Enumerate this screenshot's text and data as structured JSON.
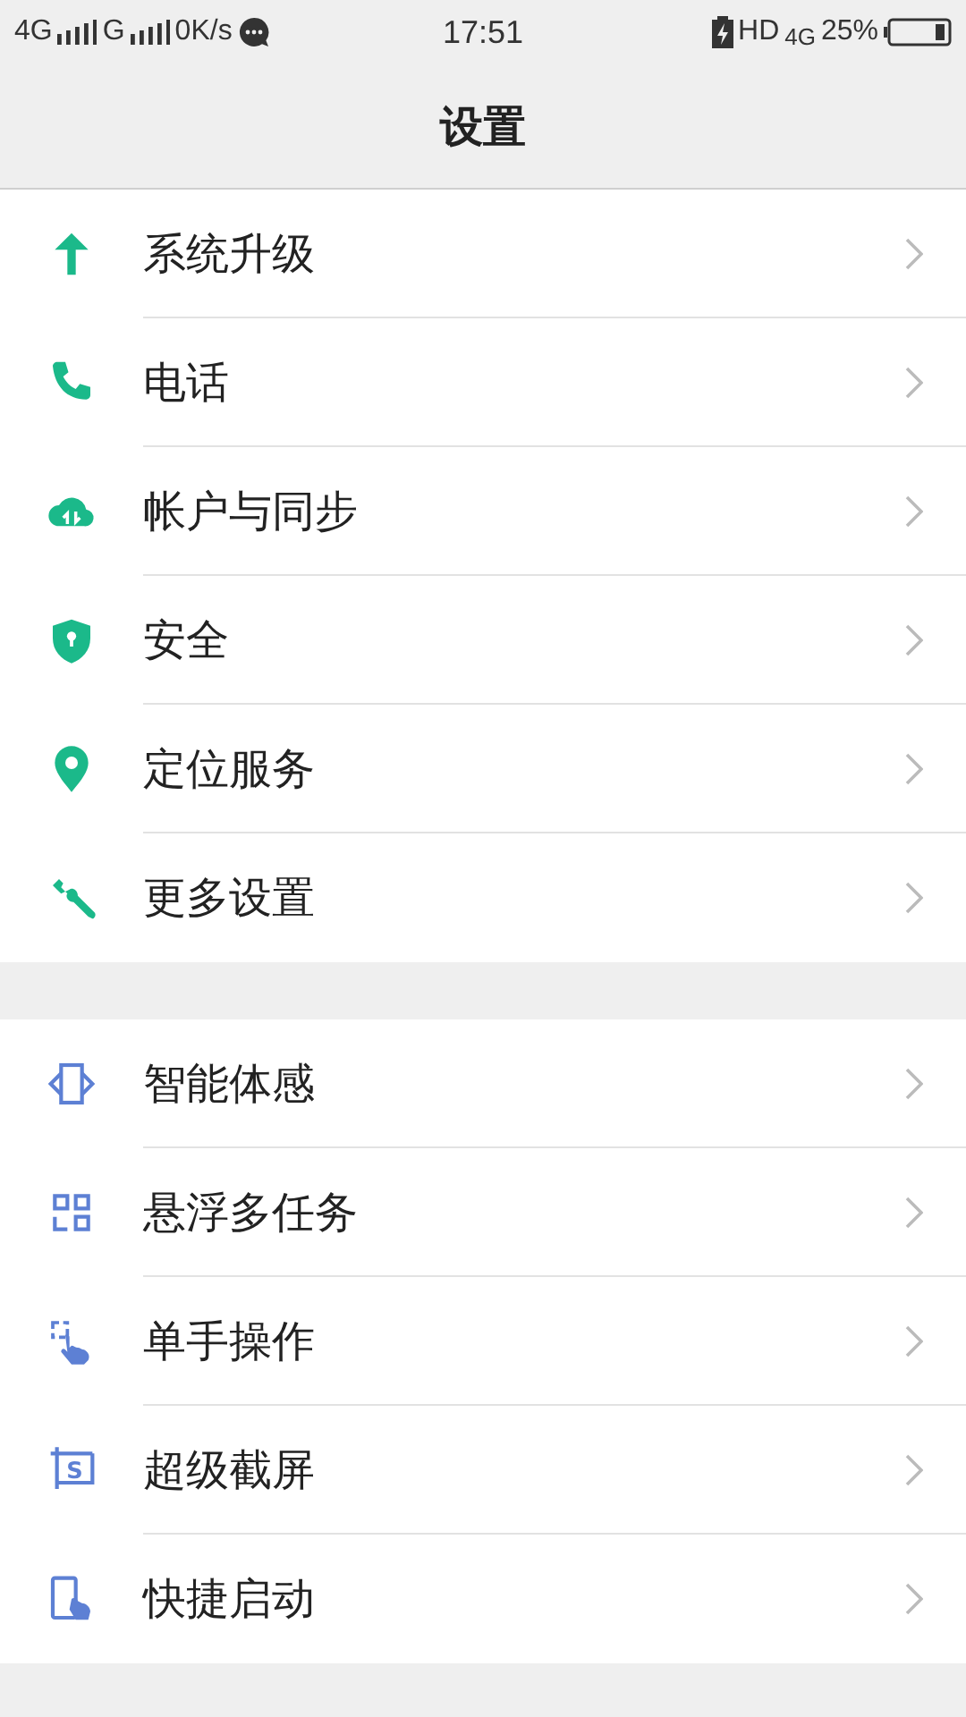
{
  "status_bar": {
    "sim1": "4G",
    "sim2": "G",
    "speed": "0K/s",
    "time": "17:51",
    "hd": "HD",
    "network": "4G",
    "battery": "25%"
  },
  "header": {
    "title": "设置"
  },
  "groups": [
    {
      "items": [
        {
          "label": "系统升级"
        },
        {
          "label": "电话"
        },
        {
          "label": "帐户与同步"
        },
        {
          "label": "安全"
        },
        {
          "label": "定位服务"
        },
        {
          "label": "更多设置"
        }
      ]
    },
    {
      "items": [
        {
          "label": "智能体感"
        },
        {
          "label": "悬浮多任务"
        },
        {
          "label": "单手操作"
        },
        {
          "label": "超级截屏",
          "icon_text": "S"
        },
        {
          "label": "快捷启动"
        }
      ]
    }
  ]
}
